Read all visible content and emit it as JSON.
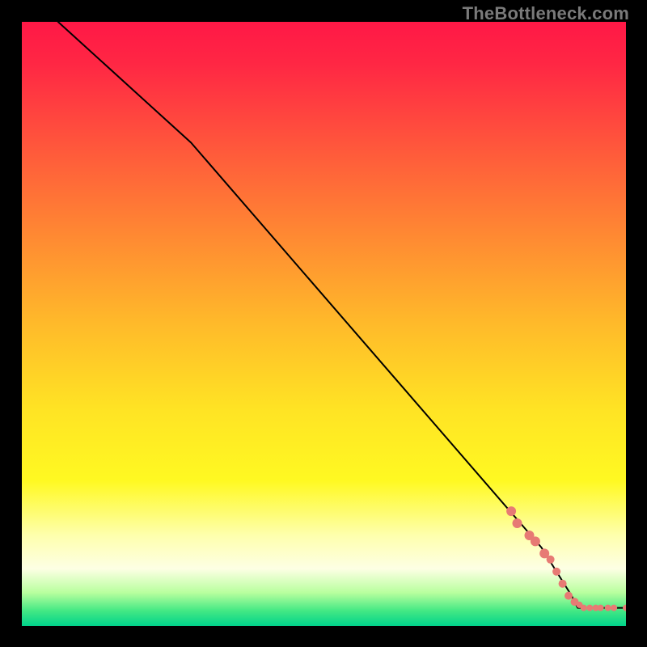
{
  "watermark": "TheBottleneck.com",
  "chart_data": {
    "type": "line",
    "title": "",
    "xlabel": "",
    "ylabel": "",
    "xlim": [
      0,
      100
    ],
    "ylim": [
      0,
      100
    ],
    "background": "gradient red→orange→yellow→pale-yellow→green (top→bottom)",
    "gradient_stops": [
      {
        "pos": 0.0,
        "color": "#ff1846"
      },
      {
        "pos": 0.07,
        "color": "#ff2744"
      },
      {
        "pos": 0.23,
        "color": "#ff5f3a"
      },
      {
        "pos": 0.36,
        "color": "#ff8b32"
      },
      {
        "pos": 0.5,
        "color": "#ffba2a"
      },
      {
        "pos": 0.64,
        "color": "#ffe324"
      },
      {
        "pos": 0.76,
        "color": "#fff922"
      },
      {
        "pos": 0.85,
        "color": "#feffad"
      },
      {
        "pos": 0.905,
        "color": "#fdffe4"
      },
      {
        "pos": 0.945,
        "color": "#b8ff9e"
      },
      {
        "pos": 0.975,
        "color": "#43e884"
      },
      {
        "pos": 1.0,
        "color": "#00d38b"
      }
    ],
    "series": [
      {
        "name": "curve",
        "style": "line",
        "color": "#000000",
        "points": [
          {
            "x": 6,
            "y": 100
          },
          {
            "x": 28,
            "y": 80
          },
          {
            "x": 86,
            "y": 13
          },
          {
            "x": 91,
            "y": 5
          },
          {
            "x": 92,
            "y": 3
          },
          {
            "x": 100,
            "y": 3
          }
        ]
      },
      {
        "name": "markers",
        "style": "points",
        "color": "#e77a74",
        "points": [
          {
            "x": 81,
            "y": 19,
            "r": 6
          },
          {
            "x": 82,
            "y": 17,
            "r": 6
          },
          {
            "x": 84,
            "y": 15,
            "r": 6
          },
          {
            "x": 85,
            "y": 14,
            "r": 6
          },
          {
            "x": 86.5,
            "y": 12,
            "r": 6
          },
          {
            "x": 87.5,
            "y": 11,
            "r": 5
          },
          {
            "x": 88.5,
            "y": 9,
            "r": 5
          },
          {
            "x": 89.5,
            "y": 7,
            "r": 5
          },
          {
            "x": 90.5,
            "y": 5,
            "r": 5
          },
          {
            "x": 91.5,
            "y": 4,
            "r": 5
          },
          {
            "x": 92.3,
            "y": 3.5,
            "r": 4
          },
          {
            "x": 93,
            "y": 3,
            "r": 4
          },
          {
            "x": 94,
            "y": 3,
            "r": 4
          },
          {
            "x": 95,
            "y": 3,
            "r": 4
          },
          {
            "x": 95.8,
            "y": 3,
            "r": 4
          },
          {
            "x": 97,
            "y": 3,
            "r": 4
          },
          {
            "x": 98,
            "y": 3,
            "r": 4
          },
          {
            "x": 100,
            "y": 3,
            "r": 4
          }
        ]
      }
    ]
  }
}
